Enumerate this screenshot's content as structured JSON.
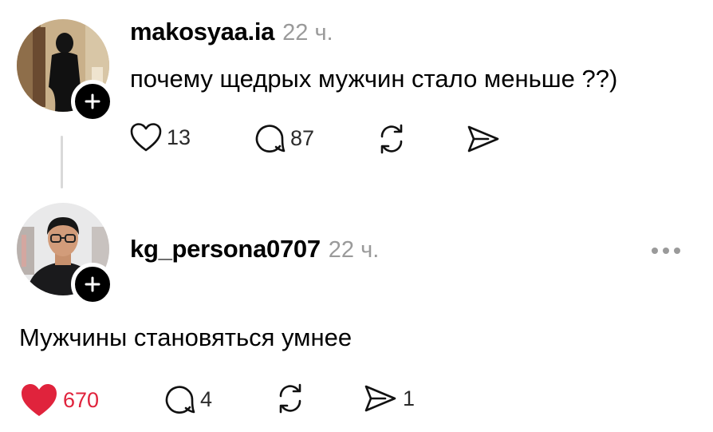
{
  "posts": [
    {
      "username": "makosyaa.ia",
      "time": "22 ч.",
      "text": "почему щедрых мужчин стало меньше ??)",
      "likes": "13",
      "comments": "87",
      "liked": false,
      "avatar": "dark-figure-photo",
      "follow_icon": "plus-icon"
    },
    {
      "username": "kg_persona0707",
      "time": "22 ч.",
      "text": "Мужчины становяться умнее",
      "likes": "670",
      "comments": "4",
      "shares": "1",
      "liked": true,
      "like_color": "#e0233c",
      "avatar": "man-with-glasses-photo",
      "follow_icon": "plus-icon"
    }
  ],
  "icons": [
    "heart-icon",
    "comment-icon",
    "repost-icon",
    "share-icon",
    "more-icon"
  ]
}
